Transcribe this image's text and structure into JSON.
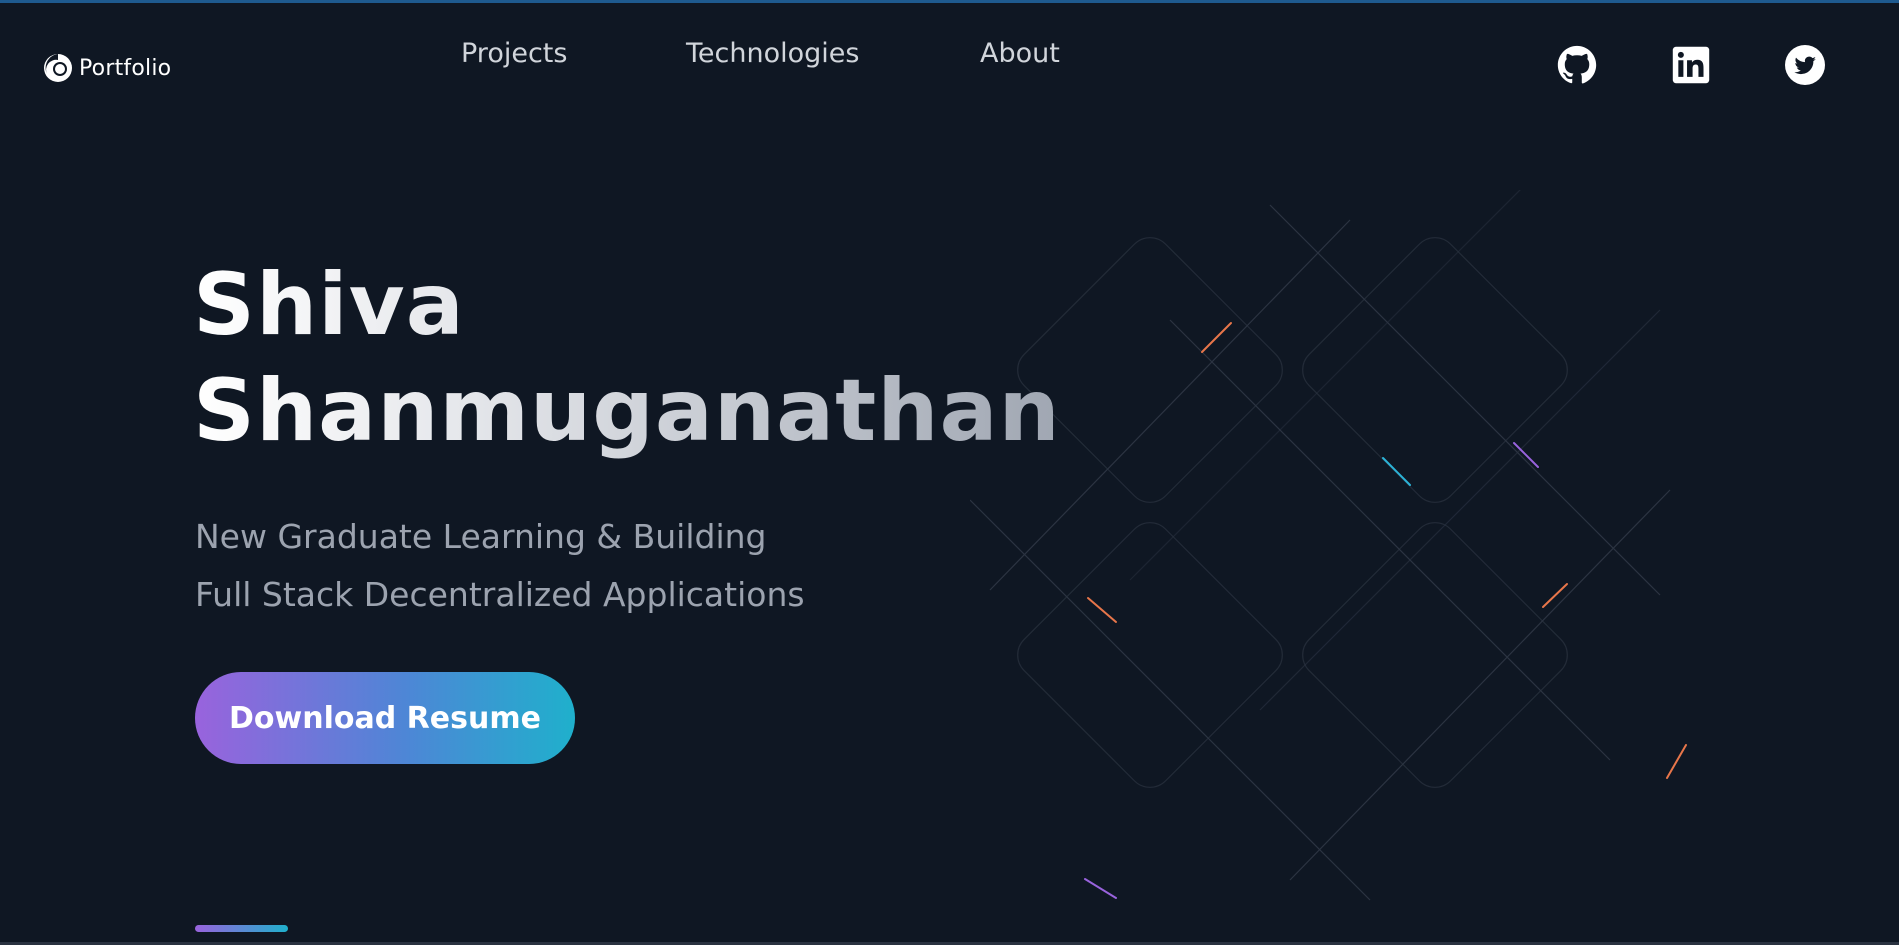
{
  "header": {
    "logo_text": "Portfolio",
    "logo_icon": "circle-swirl-icon",
    "nav": [
      {
        "label": "Projects"
      },
      {
        "label": "Technologies"
      },
      {
        "label": "About"
      }
    ],
    "social": [
      {
        "icon": "github-icon"
      },
      {
        "icon": "linkedin-icon"
      },
      {
        "icon": "twitter-icon"
      }
    ]
  },
  "hero": {
    "title_line1": "Shiva",
    "title_line2": "Shanmuganathan",
    "subtitle_line1": "New Graduate Learning & Building",
    "subtitle_line2": "Full Stack Decentralized Applications",
    "cta_label": "Download Resume"
  },
  "colors": {
    "background": "#0f1723",
    "accent_purple": "#9963dd",
    "accent_cyan": "#1fb0cc",
    "nav_text": "#d1d5db",
    "subtitle_text": "#9ca3af"
  }
}
